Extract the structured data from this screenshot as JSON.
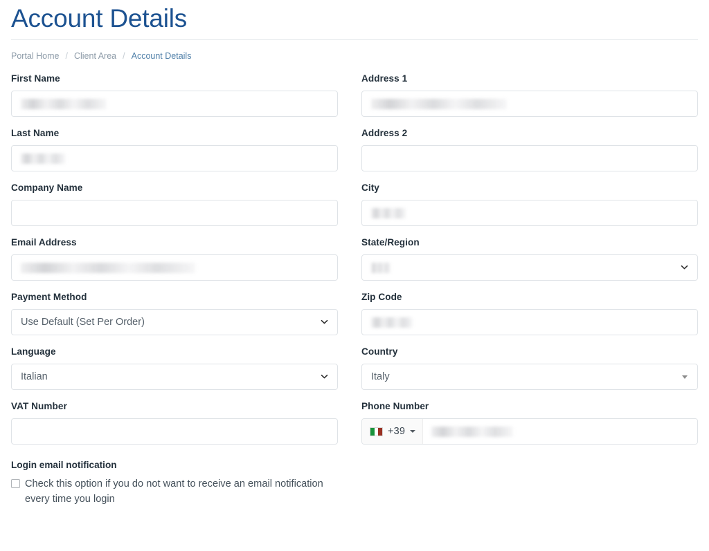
{
  "header": {
    "title": "Account Details",
    "breadcrumb": [
      {
        "label": "Portal Home",
        "current": false
      },
      {
        "label": "Client Area",
        "current": false
      },
      {
        "label": "Account Details",
        "current": true
      }
    ],
    "separator": "/"
  },
  "colors": {
    "title_blue": "#1c5291",
    "breadcrumb_muted": "#8d9ba8",
    "breadcrumb_current": "#4f7fa8",
    "label_dark": "#24313c",
    "field_border": "#dfe3e7",
    "flag_green": "#18933b",
    "flag_white": "#ffffff",
    "flag_red": "#9a3123"
  },
  "form": {
    "left": {
      "first_name": {
        "label": "First Name",
        "value": "",
        "redacted": true
      },
      "last_name": {
        "label": "Last Name",
        "value": "",
        "redacted": true
      },
      "company_name": {
        "label": "Company Name",
        "value": "",
        "redacted": false
      },
      "email_address": {
        "label": "Email Address",
        "value": "",
        "redacted": true
      },
      "payment_method": {
        "label": "Payment Method",
        "value": "Use Default (Set Per Order)",
        "icon": "chevron-down-icon"
      },
      "language": {
        "label": "Language",
        "value": "Italian",
        "icon": "chevron-down-icon"
      },
      "vat_number": {
        "label": "VAT Number",
        "value": "",
        "redacted": false
      }
    },
    "right": {
      "address1": {
        "label": "Address 1",
        "value": "",
        "redacted": true
      },
      "address2": {
        "label": "Address 2",
        "value": "",
        "redacted": false
      },
      "city": {
        "label": "City",
        "value": "",
        "redacted": true
      },
      "state_region": {
        "label": "State/Region",
        "value": "",
        "redacted": true,
        "icon": "chevron-down-icon"
      },
      "zip_code": {
        "label": "Zip Code",
        "value": "",
        "redacted": true
      },
      "country": {
        "label": "Country",
        "value": "Italy",
        "icon": "caret-down-icon"
      },
      "phone_number": {
        "label": "Phone Number",
        "dial_code": "+39",
        "flag": "flag-italy-icon",
        "value": "",
        "redacted": true
      }
    }
  },
  "notification": {
    "title": "Login email notification",
    "checkbox_checked": false,
    "description": "Check this option if you do not want to receive an email notification every time you login"
  }
}
